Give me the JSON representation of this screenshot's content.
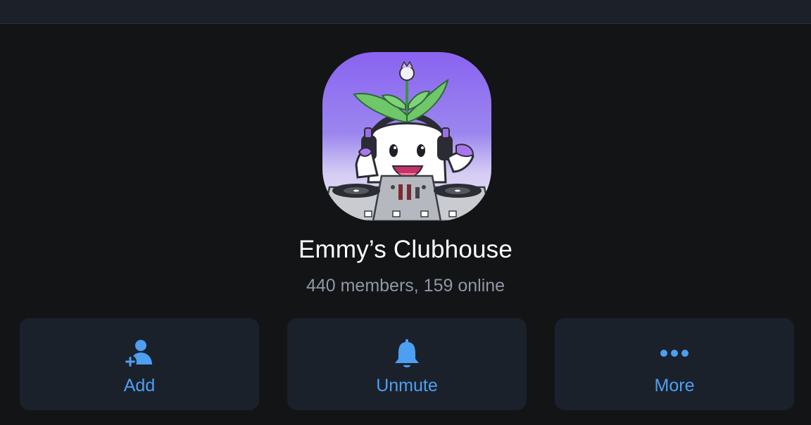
{
  "header": {},
  "group": {
    "name": "Emmy’s Clubhouse",
    "subtitle": "440 members, 159 online"
  },
  "actions": [
    {
      "label": "Add",
      "icon": "add-member-icon"
    },
    {
      "label": "Unmute",
      "icon": "bell-icon"
    },
    {
      "label": "More",
      "icon": "more-dots-icon"
    }
  ],
  "colors": {
    "background": "#131416",
    "topbar": "#1b2029",
    "card": "#1b212b",
    "accent": "#4d9ff2",
    "subtitle": "#8f98a6"
  }
}
